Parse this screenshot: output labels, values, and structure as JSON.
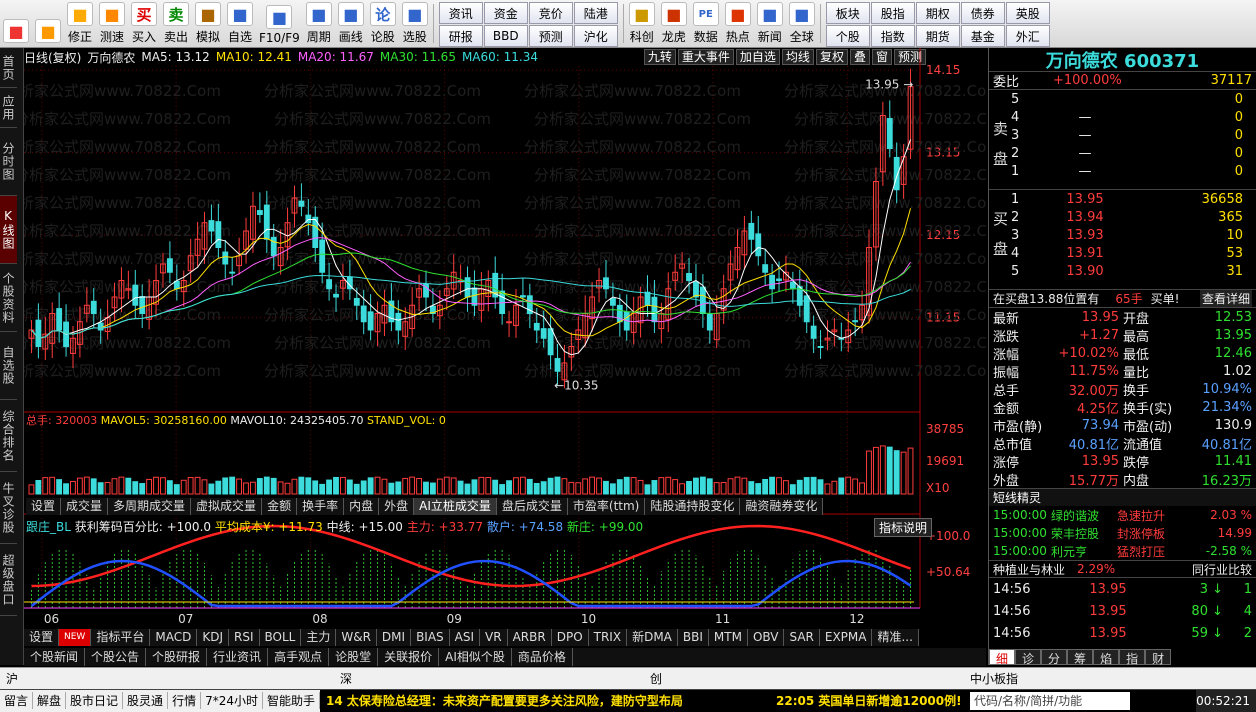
{
  "toolbar": {
    "big": [
      {
        "label": "",
        "icon": "windows-icon"
      },
      {
        "label": "",
        "icon": "back-icon"
      },
      {
        "label": "修正",
        "icon": "arrows-icon"
      },
      {
        "label": "测速",
        "icon": "clock-icon"
      },
      {
        "label": "买入",
        "icon": "buy-icon",
        "glyph": "买"
      },
      {
        "label": "卖出",
        "icon": "sell-icon",
        "glyph": "卖"
      },
      {
        "label": "模拟",
        "icon": "hammer-icon"
      },
      {
        "label": "自选",
        "icon": "star-icon"
      },
      {
        "label": "F10/F9",
        "icon": "f10-icon"
      },
      {
        "label": "周期",
        "icon": "period-icon"
      },
      {
        "label": "画线",
        "icon": "pen-icon"
      },
      {
        "label": "论股",
        "icon": "discuss-icon",
        "glyph": "论"
      },
      {
        "label": "选股",
        "icon": "select-icon"
      }
    ],
    "grid": [
      [
        "资讯",
        "研报"
      ],
      [
        "资金",
        "BBD"
      ],
      [
        "竞价",
        "预测"
      ],
      [
        "陆港",
        "沪化"
      ]
    ],
    "big2": [
      {
        "label": "科创",
        "icon": "chart-icon"
      },
      {
        "label": "龙虎",
        "icon": "dragon-icon"
      },
      {
        "label": "数据",
        "icon": "pe-icon",
        "glyph": "PE"
      },
      {
        "label": "热点",
        "icon": "hot-icon"
      },
      {
        "label": "新闻",
        "icon": "news-icon"
      },
      {
        "label": "全球",
        "icon": "globe-icon"
      }
    ],
    "grid2": [
      [
        "板块",
        "个股"
      ],
      [
        "股指",
        "指数"
      ],
      [
        "期权",
        "期货"
      ],
      [
        "债券",
        "基金"
      ],
      [
        "英股",
        "外汇"
      ]
    ]
  },
  "sidebar": [
    "首页",
    "应用",
    "分时图",
    "K线图",
    "个股资料",
    "自选股",
    "综合排名",
    "牛叉诊股",
    "超级盘口"
  ],
  "sidebar_active": 3,
  "info": {
    "period": "日线(复权)",
    "name": "万向德农",
    "ma5": "MA5: 13.12",
    "ma10": "MA10: 12.41",
    "ma20": "MA20: 11.67",
    "ma30": "MA30: 11.65",
    "ma60": "MA60: 11.34",
    "tools": [
      "九转",
      "重大事件",
      "加自选",
      "均线",
      "复权",
      "叠",
      "窗",
      "预测"
    ]
  },
  "price_axis": [
    "14.15",
    "13.15",
    "12.15",
    "11.15"
  ],
  "price_marks": {
    "high": "13.95",
    "low": "10.35"
  },
  "vol_label": {
    "total": "总手: 320003",
    "mavol5": "MAVOL5: 30258160.00",
    "mavol10": "MAVOL10: 24325405.70",
    "stand": "STAND_VOL: 0"
  },
  "vol_axis": [
    "38785",
    "19691",
    "X10"
  ],
  "tabs1": [
    "设置",
    "成交量",
    "多周期成交量",
    "虚拟成交量",
    "金额",
    "换手率",
    "内盘",
    "外盘",
    "AI立桩成交量",
    "盘后成交量",
    "市盈率(ttm)",
    "陆股通持股变化",
    "融资融券变化"
  ],
  "tabs1_active": 8,
  "ind_label": {
    "a": "跟庄_BL",
    "b": "获利筹码百分比: +100.0",
    "c": "平均成本¥: +11.73",
    "d": "中线: +15.00",
    "e": "主力: +33.77",
    "f": "散户: +74.58",
    "g": "新庄: +99.00",
    "btn": "指标说明"
  },
  "ind_axis": [
    "+100.0",
    "+50.64"
  ],
  "months": [
    "06",
    "07",
    "08",
    "09",
    "10",
    "11",
    "12"
  ],
  "tabs2": [
    "设置",
    "NEW",
    "指标平台",
    "MACD",
    "KDJ",
    "RSI",
    "BOLL",
    "主力",
    "W&R",
    "DMI",
    "BIAS",
    "ASI",
    "VR",
    "ARBR",
    "DPO",
    "TRIX",
    "新DMA",
    "BBI",
    "MTM",
    "OBV",
    "SAR",
    "EXPMA",
    "精准..."
  ],
  "tabs3": [
    "个股新闻",
    "个股公告",
    "个股研报",
    "行业资讯",
    "高手观点",
    "论股堂",
    "关联报价",
    "AI相似个股",
    "商品价格"
  ],
  "watermark": "分析家公式网www.70822.Com",
  "quote": {
    "title": "万向德农 600371",
    "wb_label": "委比",
    "wb_val": "+100.00%",
    "wb_num": "37117",
    "sell": [
      {
        "i": "5",
        "p": "",
        "v": "0"
      },
      {
        "i": "4",
        "p": "—",
        "v": "0"
      },
      {
        "i": "3",
        "p": "—",
        "v": "0"
      },
      {
        "i": "2",
        "p": "—",
        "v": "0"
      },
      {
        "i": "1",
        "p": "—",
        "v": "0"
      }
    ],
    "sell_label": [
      "卖",
      "盘"
    ],
    "buy": [
      {
        "i": "1",
        "p": "13.95",
        "v": "36658"
      },
      {
        "i": "2",
        "p": "13.94",
        "v": "365"
      },
      {
        "i": "3",
        "p": "13.93",
        "v": "10"
      },
      {
        "i": "4",
        "p": "13.91",
        "v": "53"
      },
      {
        "i": "5",
        "p": "13.90",
        "v": "31"
      }
    ],
    "buy_label": [
      "买",
      "盘"
    ],
    "note": "在买盘13.88位置有",
    "note_val": "65手",
    "note_buy": "买单!",
    "note_detail": "查看详细",
    "stats": [
      [
        "最新",
        "13.95",
        "开盘",
        "12.53"
      ],
      [
        "涨跌",
        "+1.27",
        "最高",
        "13.95"
      ],
      [
        "涨幅",
        "+10.02%",
        "最低",
        "12.46"
      ],
      [
        "振幅",
        "11.75%",
        "量比",
        "1.02"
      ],
      [
        "总手",
        "32.00万",
        "换手",
        "10.94%"
      ],
      [
        "金额",
        "4.25亿",
        "换手(实)",
        "21.34%"
      ],
      [
        "市盈(静)",
        "73.94",
        "市盈(动)",
        "130.9"
      ],
      [
        "总市值",
        "40.81亿",
        "流通值",
        "40.81亿"
      ],
      [
        "涨停",
        "13.95",
        "跌停",
        "11.41"
      ],
      [
        "外盘",
        "15.77万",
        "内盘",
        "16.23万"
      ]
    ],
    "elves_title": "短线精灵",
    "elves": [
      [
        "15:00:00",
        "绿的谐波",
        "急速拉升",
        "2.03 %"
      ],
      [
        "15:00:00",
        "荣丰控股",
        "封涨停板",
        "14.99"
      ],
      [
        "15:00:00",
        "利元亨",
        "猛烈打压",
        "-2.58 %"
      ]
    ],
    "industry": "种植业与林业",
    "industry_val": "2.29%",
    "industry_cmp": "同行业比较",
    "ticks": [
      [
        "14:56",
        "13.95",
        "3",
        "1"
      ],
      [
        "14:56",
        "13.95",
        "80",
        "4"
      ],
      [
        "14:56",
        "13.95",
        "59",
        "2"
      ]
    ],
    "tabs": [
      "细",
      "诊",
      "分",
      "筹",
      "焰",
      "指",
      "财"
    ]
  },
  "status": {
    "sh": "沪",
    "sz": "深",
    "cy": "创",
    "zx": "中小板指"
  },
  "ticker": {
    "items": [
      "留言",
      "解盘",
      "股市日记",
      "股灵通",
      "行情",
      "7*24小时",
      "智能助手"
    ],
    "news1": "14 太保寿险总经理：未来资产配置要更多关注风险，建防守型布局",
    "news2": "22:05 英国单日新增逾12000例!",
    "search": "代码/名称/简拼/功能",
    "time": "00:52:21"
  },
  "chart_data": {
    "type": "candlestick",
    "title": "万向德农 600371 日线(复权)",
    "ylim": [
      10.2,
      14.2
    ],
    "x_months": [
      "06",
      "07",
      "08",
      "09",
      "10",
      "11",
      "12"
    ],
    "high_label": 13.95,
    "low_label": 10.35,
    "ma_values": {
      "MA5": 13.12,
      "MA10": 12.41,
      "MA20": 11.67,
      "MA30": 11.65,
      "MA60": 11.34
    },
    "close_series": [
      11.0,
      10.8,
      10.95,
      11.2,
      11.0,
      10.8,
      10.9,
      11.1,
      11.3,
      11.2,
      11.0,
      11.15,
      11.4,
      11.6,
      11.5,
      11.3,
      11.2,
      11.4,
      11.6,
      11.8,
      11.7,
      11.5,
      11.6,
      11.9,
      12.1,
      12.3,
      12.2,
      12.0,
      11.8,
      11.7,
      11.9,
      12.2,
      12.5,
      12.4,
      12.1,
      11.9,
      12.0,
      12.3,
      12.6,
      12.5,
      12.3,
      12.0,
      11.7,
      11.5,
      11.4,
      11.6,
      11.5,
      11.3,
      11.1,
      11.0,
      11.2,
      11.3,
      11.1,
      11.0,
      11.1,
      11.3,
      11.5,
      11.4,
      11.2,
      11.3,
      11.5,
      11.7,
      11.6,
      11.4,
      11.3,
      11.5,
      11.6,
      11.4,
      11.2,
      11.1,
      11.3,
      11.4,
      11.2,
      11.0,
      10.9,
      10.7,
      10.5,
      10.6,
      10.8,
      11.0,
      11.2,
      11.4,
      11.6,
      11.5,
      11.3,
      11.1,
      11.0,
      11.2,
      11.4,
      11.3,
      11.1,
      11.2,
      11.5,
      11.7,
      11.8,
      11.6,
      11.4,
      11.2,
      11.0,
      11.2,
      11.5,
      11.8,
      12.0,
      12.2,
      12.1,
      11.9,
      11.7,
      11.5,
      11.6,
      11.7,
      11.5,
      11.3,
      11.1,
      10.9,
      10.8,
      10.9,
      11.0,
      10.9,
      11.0,
      11.1,
      11.3,
      12.0,
      12.8,
      13.6,
      13.2,
      12.7,
      13.1,
      13.95
    ]
  }
}
